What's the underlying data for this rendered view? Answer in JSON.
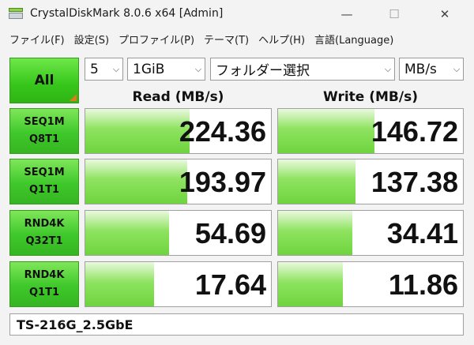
{
  "window": {
    "title": "CrystalDiskMark 8.0.6 x64 [Admin]",
    "minimize": "—",
    "maximize": "☐",
    "close": "✕"
  },
  "menu": [
    "ファイル(F)",
    "設定(S)",
    "プロファイル(P)",
    "テーマ(T)",
    "ヘルプ(H)",
    "言語(Language)"
  ],
  "controls": {
    "all_label": "All",
    "count": "5",
    "size": "1GiB",
    "folder": "フォルダー選択",
    "unit": "MB/s"
  },
  "headers": {
    "read": "Read (MB/s)",
    "write": "Write (MB/s)"
  },
  "rows": [
    {
      "line1": "SEQ1M",
      "line2": "Q8T1",
      "read": "224.36",
      "write": "146.72",
      "read_fill": 0.56,
      "write_fill": 0.52
    },
    {
      "line1": "SEQ1M",
      "line2": "Q1T1",
      "read": "193.97",
      "write": "137.38",
      "read_fill": 0.55,
      "write_fill": 0.42
    },
    {
      "line1": "RND4K",
      "line2": "Q32T1",
      "read": "54.69",
      "write": "34.41",
      "read_fill": 0.45,
      "write_fill": 0.4
    },
    {
      "line1": "RND4K",
      "line2": "Q1T1",
      "read": "17.64",
      "write": "11.86",
      "read_fill": 0.37,
      "write_fill": 0.35
    }
  ],
  "footer": {
    "label": "TS-216G_2.5GbE"
  },
  "colors": {
    "accent_green": "#36c61a",
    "bar_green": "#8ee360",
    "corner_orange": "#e07a1a"
  }
}
